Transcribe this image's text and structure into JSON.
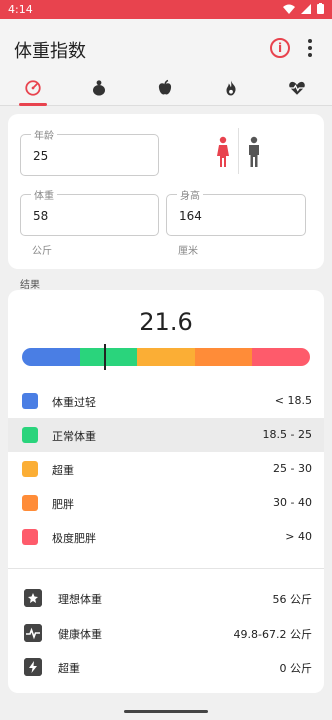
{
  "status": {
    "time": "4:14"
  },
  "app": {
    "title": "体重指数"
  },
  "tabs": [
    {
      "name": "gauge-icon",
      "active": true
    },
    {
      "name": "body-icon",
      "active": false
    },
    {
      "name": "apple-icon",
      "active": false
    },
    {
      "name": "flame-icon",
      "active": false
    },
    {
      "name": "heartbeat-icon",
      "active": false
    }
  ],
  "inputs": {
    "age": {
      "label": "年龄",
      "value": "25"
    },
    "weight": {
      "label": "体重",
      "value": "58",
      "unit": "公斤"
    },
    "height": {
      "label": "身高",
      "value": "164",
      "unit": "厘米"
    }
  },
  "gender": {
    "selected": "female"
  },
  "results_label": "结果",
  "result": {
    "bmi": "21.6",
    "scale_colors": [
      "#4a7ee4",
      "#2ad47c",
      "#fbae35",
      "#ff8c38",
      "#fe5b6b"
    ],
    "categories": [
      {
        "label": "体重过轻",
        "range": "< 18.5",
        "color": "#4a7ee4",
        "highlight": false
      },
      {
        "label": "正常体重",
        "range": "18.5  -  25",
        "color": "#2ad47c",
        "highlight": true
      },
      {
        "label": "超重",
        "range": "25  -  30",
        "color": "#fbae35",
        "highlight": false
      },
      {
        "label": "肥胖",
        "range": "30  -  40",
        "color": "#ff8c38",
        "highlight": false
      },
      {
        "label": "极度肥胖",
        "range": "> 40",
        "color": "#fe5b6b",
        "highlight": false
      }
    ],
    "details": [
      {
        "icon": "star-badge-icon",
        "label": "理想体重",
        "value": "56 公斤"
      },
      {
        "icon": "pulse-badge-icon",
        "label": "健康体重",
        "value": "49.8-67.2 公斤"
      },
      {
        "icon": "bolt-badge-icon",
        "label": "超重",
        "value": "0 公斤"
      }
    ]
  },
  "colors": {
    "accent": "#e8434e",
    "female": "#e8434e",
    "male": "#555555"
  }
}
